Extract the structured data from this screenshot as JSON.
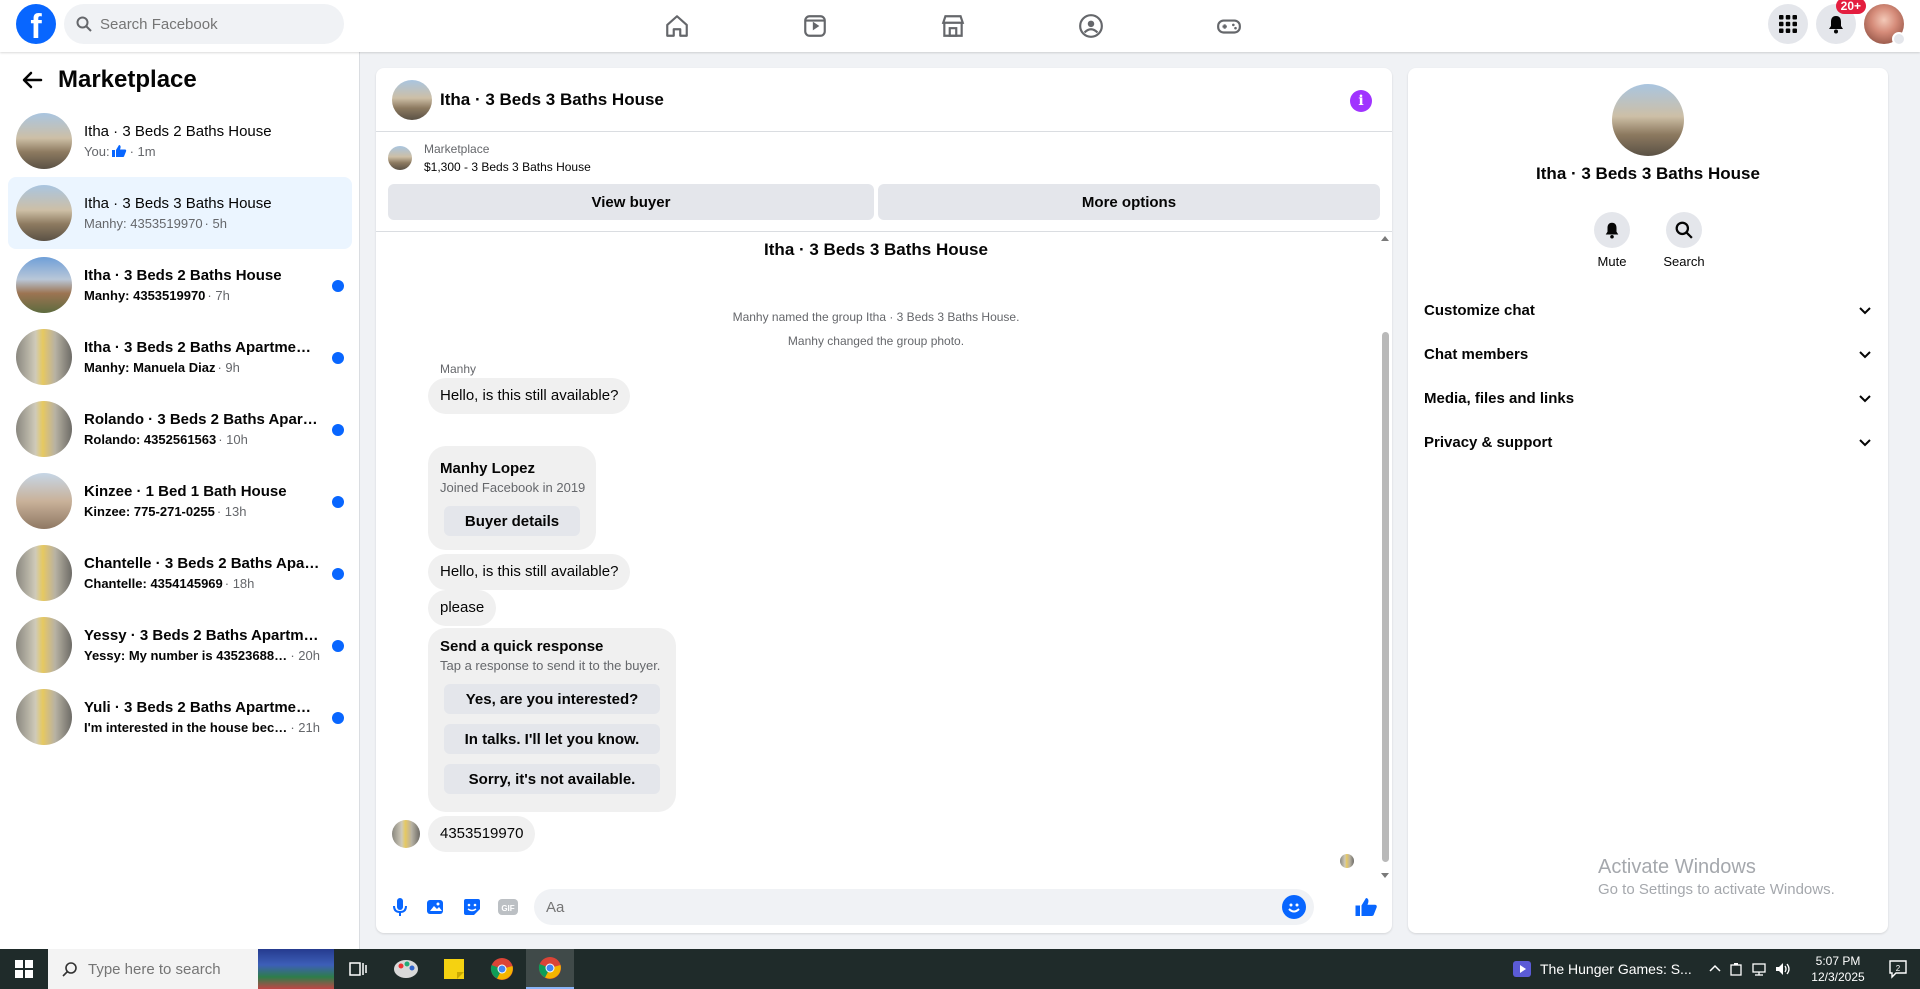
{
  "top": {
    "logo": "f",
    "search_placeholder": "Search Facebook",
    "notif_badge": "20+",
    "nav_icons": [
      "home-icon",
      "video-icon",
      "marketplace-icon",
      "groups-icon",
      "gaming-icon"
    ]
  },
  "sidebar": {
    "title": "Marketplace",
    "conversations": [
      {
        "title": "Itha · 3 Beds 2 Baths House",
        "prefix": "You: ",
        "msg": "",
        "time": " · 1m",
        "unread": false,
        "avatar": "house"
      },
      {
        "title": "Itha · 3 Beds 3 Baths House",
        "prefix": "",
        "msg": "Manhy: 4353519970",
        "time": " · 5h",
        "unread": false,
        "active": true,
        "avatar": "house"
      },
      {
        "title": "Itha · 3 Beds 2 Baths House",
        "prefix": "",
        "msg": "Manhy: 4353519970",
        "time": " · 7h",
        "unread": true,
        "avatar": "house2"
      },
      {
        "title": "Itha · 3 Beds 2 Baths Apartment/...",
        "prefix": "",
        "msg": "Manhy: Manuela Diaz",
        "time": " · 9h",
        "unread": true,
        "avatar": "room"
      },
      {
        "title": "Rolando · 3 Beds 2 Baths Apartm...",
        "prefix": "",
        "msg": "Rolando: 4352561563",
        "time": " · 10h",
        "unread": true,
        "avatar": "room"
      },
      {
        "title": "Kinzee · 1 Bed 1 Bath House",
        "prefix": "",
        "msg": "Kinzee: 775-271-0255",
        "time": " · 13h",
        "unread": true,
        "avatar": "ranch"
      },
      {
        "title": "Chantelle · 3 Beds 2 Baths Apart...",
        "prefix": "",
        "msg": "Chantelle: 4354145969",
        "time": " · 18h",
        "unread": true,
        "avatar": "room"
      },
      {
        "title": "Yessy · 3 Beds 2 Baths Apartmen...",
        "prefix": "",
        "msg": "Yessy: My number is 4352368809...",
        "time": " · 20h",
        "unread": true,
        "avatar": "room"
      },
      {
        "title": "Yuli · 3 Beds 2 Baths Apartment/...",
        "prefix": "",
        "msg": "I'm interested in the house becau...",
        "time": " · 21h",
        "unread": true,
        "avatar": "room"
      }
    ]
  },
  "chat": {
    "title": "Itha · 3 Beds 3 Baths House",
    "listing_source": "Marketplace",
    "listing_price": "$1,300 - 3 Beds 3 Baths House",
    "btn_view_buyer": "View buyer",
    "btn_more_options": "More options",
    "center_title": "Itha · 3 Beds 3 Baths House",
    "sys1": "Manhy named the group Itha · 3 Beds 3 Baths House.",
    "sys2": "Manhy changed the group photo.",
    "sender": "Manhy",
    "msg1": "Hello, is this still available?",
    "card_name": "Manhy Lopez",
    "card_joined": "Joined Facebook in 2019",
    "card_btn": "Buyer details",
    "msg2": "Hello, is this still available?",
    "msg3": "please",
    "qr_title": "Send a quick response",
    "qr_sub": "Tap a response to send it to the buyer.",
    "qr1": "Yes, are you interested?",
    "qr2": "In talks. I'll let you know.",
    "qr3": "Sorry, it's not available.",
    "msg4": "4353519970",
    "composer_placeholder": "Aa",
    "accent": "#0866ff"
  },
  "rpanel": {
    "title": "Itha · 3 Beds 3 Baths House",
    "mute": "Mute",
    "search": "Search",
    "sections": [
      "Customize chat",
      "Chat members",
      "Media, files and links",
      "Privacy & support"
    ],
    "wm1": "Activate Windows",
    "wm2": "Go to Settings to activate Windows."
  },
  "taskbar": {
    "search_placeholder": "Type here to search",
    "media": "The Hunger Games: S...",
    "time": "5:07 PM",
    "date": "12/3/2025"
  }
}
